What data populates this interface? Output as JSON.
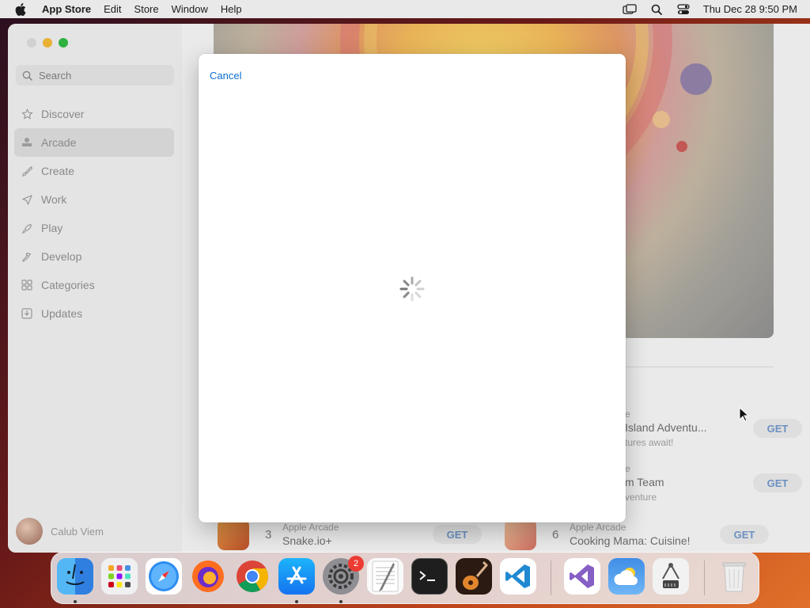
{
  "menubar": {
    "app_name": "App Store",
    "items": [
      "Edit",
      "Store",
      "Window",
      "Help"
    ],
    "clock": "Thu Dec 28  9:50 PM"
  },
  "sidebar": {
    "search_placeholder": "Search",
    "items": [
      {
        "label": "Discover",
        "icon": "star-icon"
      },
      {
        "label": "Arcade",
        "icon": "arcade-icon"
      },
      {
        "label": "Create",
        "icon": "brush-icon"
      },
      {
        "label": "Work",
        "icon": "paper-plane-icon"
      },
      {
        "label": "Play",
        "icon": "rocket-icon"
      },
      {
        "label": "Develop",
        "icon": "hammer-icon"
      },
      {
        "label": "Categories",
        "icon": "grid-icon"
      },
      {
        "label": "Updates",
        "icon": "download-icon"
      }
    ],
    "active_item": "Arcade",
    "user_name": "Calub Viem"
  },
  "main": {
    "rows": [
      {
        "rank": "",
        "subtitle": "e",
        "title": "Island Adventu...",
        "desc": "tures await!",
        "action": "GET"
      },
      {
        "rank": "",
        "subtitle": "e",
        "title": "m Team",
        "desc": "venture",
        "action": "GET"
      },
      {
        "rank": "3",
        "subtitle": "Apple Arcade",
        "title": "Snake.io+",
        "desc": "",
        "action": "GET"
      },
      {
        "rank": "6",
        "subtitle": "Apple Arcade",
        "title": "Cooking Mama: Cuisine!",
        "desc": "",
        "action": "GET"
      }
    ]
  },
  "sheet": {
    "cancel_label": "Cancel"
  },
  "dock": {
    "apps": [
      {
        "name": "Finder",
        "icon": "finder-icon",
        "running": true
      },
      {
        "name": "Launchpad",
        "icon": "launchpad-icon",
        "running": false
      },
      {
        "name": "Safari",
        "icon": "safari-icon",
        "running": false
      },
      {
        "name": "Firefox",
        "icon": "firefox-icon",
        "running": false
      },
      {
        "name": "Chrome",
        "icon": "chrome-icon",
        "running": false
      },
      {
        "name": "App Store",
        "icon": "app-store-icon",
        "running": true
      },
      {
        "name": "System Settings",
        "icon": "settings-icon",
        "running": true,
        "badge": "2"
      },
      {
        "name": "TextEdit",
        "icon": "textedit-icon",
        "running": false
      },
      {
        "name": "Terminal",
        "icon": "terminal-icon",
        "running": false
      },
      {
        "name": "GarageBand",
        "icon": "guitar-icon",
        "running": false
      },
      {
        "name": "VS Code",
        "icon": "vscode-icon",
        "running": false
      },
      {
        "name": "Visual Studio",
        "icon": "visual-studio-icon",
        "running": false
      },
      {
        "name": "Weather",
        "icon": "weather-icon",
        "running": false
      },
      {
        "name": "Scanner",
        "icon": "scanner-icon",
        "running": false
      },
      {
        "name": "Trash",
        "icon": "trash-icon",
        "running": false
      }
    ]
  }
}
